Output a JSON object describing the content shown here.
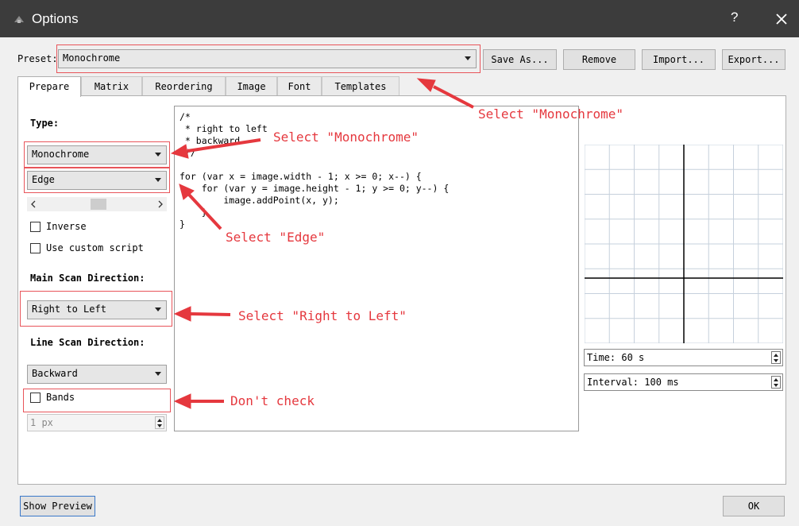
{
  "window": {
    "title": "Options",
    "help": "?"
  },
  "preset": {
    "label": "Preset:",
    "value": "Monochrome"
  },
  "buttons": {
    "save_as": "Save As...",
    "remove": "Remove",
    "import": "Import...",
    "export": "Export...",
    "show_preview": "Show Preview",
    "ok": "OK"
  },
  "tabs": [
    "Prepare",
    "Matrix",
    "Reordering",
    "Image",
    "Font",
    "Templates"
  ],
  "prepare": {
    "type_label": "Type:",
    "type_value": "Monochrome",
    "mode_value": "Edge",
    "inverse_label": "Inverse",
    "custom_script_label": "Use custom script",
    "main_scan_label": "Main Scan Direction:",
    "main_scan_value": "Right to Left",
    "line_scan_label": "Line Scan Direction:",
    "line_scan_value": "Backward",
    "bands_label": "Bands",
    "bands_width": "1 px"
  },
  "script_lines": [
    "/*",
    " * right to left",
    " * backward",
    " */",
    "",
    "for (var x = image.width - 1; x >= 0; x--) {",
    "    for (var y = image.height - 1; y >= 0; y--) {",
    "        image.addPoint(x, y);",
    "    }",
    "}"
  ],
  "preview": {
    "time": "Time: 60 s",
    "interval": "Interval: 100 ms"
  },
  "annotations": {
    "select_preset": "Select \"Monochrome\"",
    "select_type": "Select \"Monochrome\"",
    "select_edge": "Select \"Edge\"",
    "select_direction": "Select \"Right to Left\"",
    "dont_check": "Don't check"
  },
  "colors": {
    "annotation": "#e5383e",
    "titlebar": "#3c3c3c"
  }
}
